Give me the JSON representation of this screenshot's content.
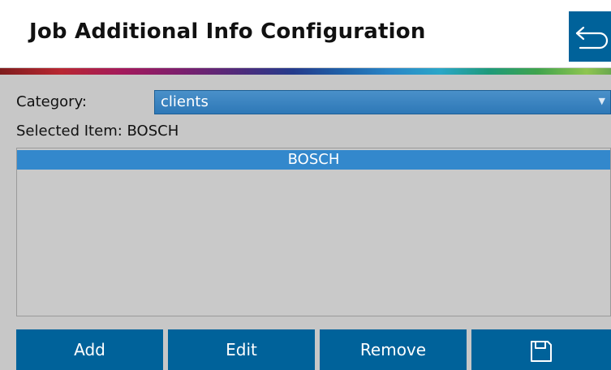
{
  "header": {
    "title": "Job Additional Info Configuration",
    "back_icon": "undo-arrow-icon"
  },
  "form": {
    "category_label": "Category:",
    "category_value": "clients",
    "selected_label": "Selected Item: BOSCH"
  },
  "list": {
    "items": [
      "BOSCH"
    ],
    "selected_index": 0
  },
  "footer": {
    "add_label": "Add",
    "edit_label": "Edit",
    "remove_label": "Remove",
    "save_icon": "save-icon"
  },
  "colors": {
    "primary_button": "#00629a",
    "selection": "#3388cc",
    "background": "#c7c7c7"
  }
}
